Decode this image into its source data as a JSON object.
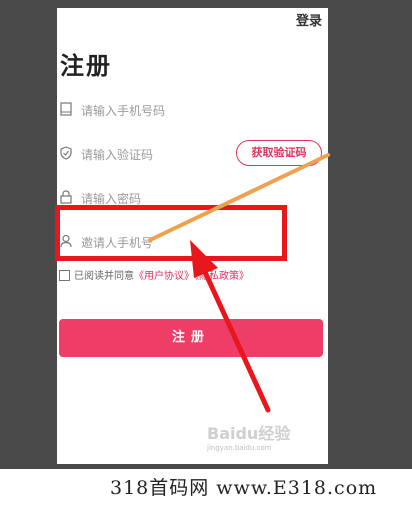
{
  "header": {
    "login_label": "登录"
  },
  "page": {
    "title": "注册"
  },
  "form": {
    "phone_placeholder": "请输入手机号码",
    "code_placeholder": "请输入验证码",
    "get_code_label": "获取验证码",
    "password_placeholder": "请输入密码",
    "inviter_placeholder": "邀请人手机号"
  },
  "agreement": {
    "prefix": "已阅读并同意",
    "user_agreement": "《用户协议》",
    "privacy_policy": "《隐私政策》"
  },
  "submit_label": "注册",
  "watermark": {
    "brand": "Baidu经验",
    "url": "jingyan.baidu.com"
  },
  "footer": {
    "text": "318首码网 www.E318.com"
  },
  "colors": {
    "accent": "#ee3d66",
    "annotation": "#e8161d",
    "annotation_line": "#f0a050"
  }
}
